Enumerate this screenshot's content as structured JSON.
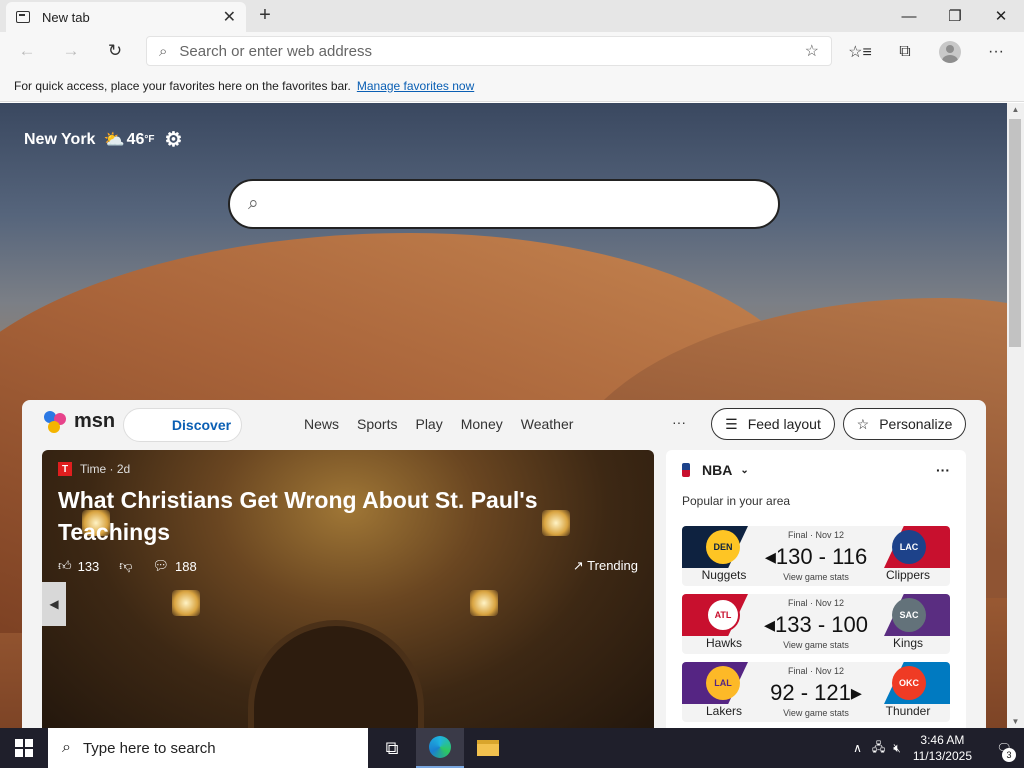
{
  "tab": {
    "title": "New tab",
    "close": "✕",
    "new": "+"
  },
  "window": {
    "minimize": "—",
    "maximize": "❐",
    "close": "✕"
  },
  "toolbar": {
    "back": "←",
    "forward": "→",
    "refresh": "↻",
    "address_placeholder": "Search or enter web address",
    "star": "☆",
    "favorites": "☆≡",
    "collections": "⧉",
    "menu": "···"
  },
  "favbar": {
    "text": "For quick access, place your favorites here on the favorites bar.",
    "link": "Manage favorites now"
  },
  "weather": {
    "city": "New York",
    "temp": "46",
    "unit": "°F"
  },
  "msn": {
    "logo": "msn",
    "discover": "Discover",
    "nav": [
      "News",
      "Sports",
      "Play",
      "Money",
      "Weather"
    ],
    "more": "···",
    "feed_layout": "Feed layout",
    "personalize": "Personalize"
  },
  "hero": {
    "source": "Time · 2d",
    "title": "What Christians Get Wrong About St. Paul's Teachings",
    "likes": "133",
    "comments": "188",
    "trending": "Trending"
  },
  "sports": {
    "league": "NBA",
    "popular": "Popular in your area",
    "more": "···",
    "games": [
      {
        "status": "Final · Nov 12",
        "score": "◂130 - 116",
        "stats": "View game stats",
        "home": "Nuggets",
        "away": "Clippers",
        "home_color": "#0e2240",
        "away_color": "#c8102e",
        "home_abbr": "DEN",
        "away_abbr": "LAC"
      },
      {
        "status": "Final · Nov 12",
        "score": "◂133 - 100",
        "stats": "View game stats",
        "home": "Hawks",
        "away": "Kings",
        "home_color": "#c8102e",
        "away_color": "#5a2d81",
        "home_abbr": "ATL",
        "away_abbr": "SAC"
      },
      {
        "status": "Final · Nov 12",
        "score": "92 - 121▸",
        "stats": "View game stats",
        "home": "Lakers",
        "away": "Thunder",
        "home_color": "#552583",
        "away_color": "#007ac1",
        "home_abbr": "LAL",
        "away_abbr": "OKC"
      }
    ]
  },
  "taskbar": {
    "search_placeholder": "Type here to search",
    "time": "3:46 AM",
    "date": "11/13/2025",
    "notifications": "3"
  }
}
